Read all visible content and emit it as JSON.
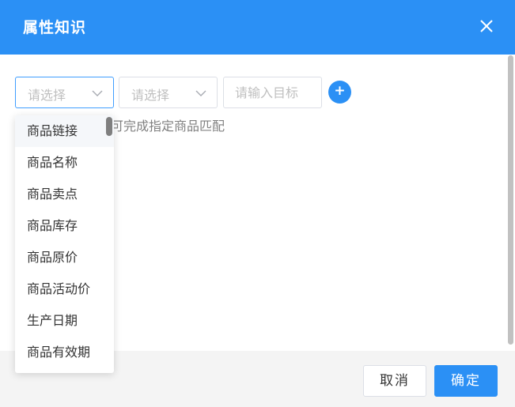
{
  "dialog": {
    "title": "属性知识",
    "accent_color": "#2b90f5"
  },
  "rule_row": {
    "select1_placeholder": "请选择",
    "select2_placeholder": "请选择",
    "target_placeholder": "请输入目标",
    "add_label": "+"
  },
  "hint": "可完成指定商品匹配",
  "dropdown": {
    "options": [
      "商品链接",
      "商品名称",
      "商品卖点",
      "商品库存",
      "商品原价",
      "商品活动价",
      "生产日期",
      "商品有效期"
    ],
    "highlighted": "商品链接"
  },
  "footer": {
    "cancel_label": "取消",
    "confirm_label": "确定"
  }
}
